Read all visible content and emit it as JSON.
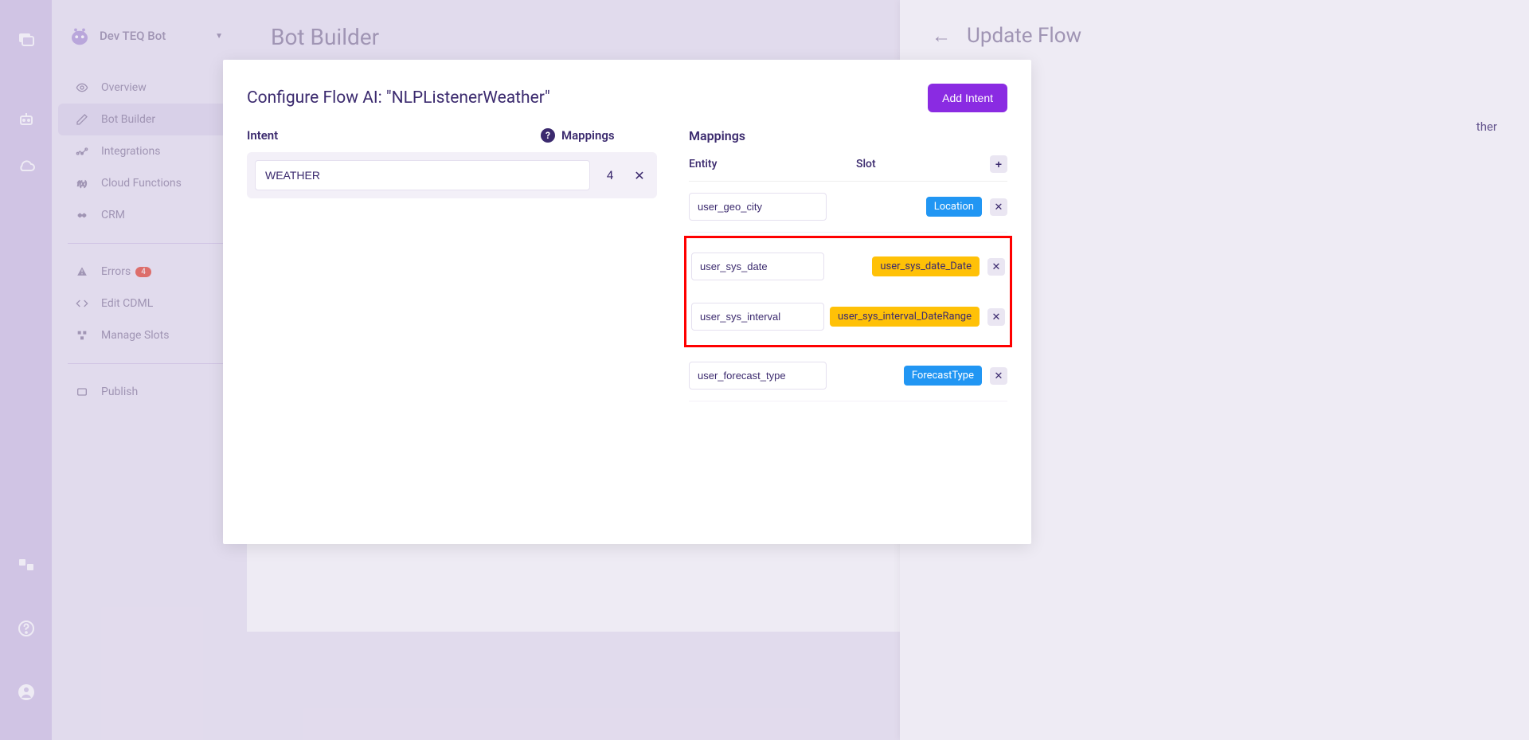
{
  "rail": {
    "icons": [
      "chat-icon",
      "bot-icon",
      "cloud-icon"
    ],
    "bottom_icons": [
      "translate-icon",
      "help-icon",
      "user-icon"
    ]
  },
  "sidebar": {
    "title": "Dev TEQ Bot",
    "items": [
      {
        "label": "Overview",
        "icon": "eye-icon"
      },
      {
        "label": "Bot Builder",
        "icon": "pencil-icon",
        "active": true
      },
      {
        "label": "Integrations",
        "icon": "share-icon"
      },
      {
        "label": "Cloud Functions",
        "icon": "function-icon"
      },
      {
        "label": "CRM",
        "icon": "handshake-icon"
      }
    ],
    "items2": [
      {
        "label": "Errors",
        "icon": "alert-icon",
        "badge": "4"
      },
      {
        "label": "Edit CDML",
        "icon": "code-icon"
      },
      {
        "label": "Manage Slots",
        "icon": "cubes-icon"
      }
    ],
    "items3": [
      {
        "label": "Publish",
        "icon": "publish-icon"
      }
    ]
  },
  "main": {
    "title": "Bot Builder"
  },
  "drawer": {
    "title": "Update Flow",
    "subpath_suffix": "ther"
  },
  "modal": {
    "title": "Configure Flow AI: \"NLPListenerWeather\"",
    "add_intent_label": "Add Intent",
    "columns": {
      "intent": "Intent",
      "mappings": "Mappings"
    },
    "intent_row": {
      "value": "WEATHER",
      "count": "4"
    },
    "mappings": {
      "title": "Mappings",
      "headers": {
        "entity": "Entity",
        "slot": "Slot"
      },
      "rows": [
        {
          "entity": "user_geo_city",
          "slot": "Location",
          "color": "blue",
          "highlight": false
        },
        {
          "entity": "user_sys_date",
          "slot": "user_sys_date_Date",
          "color": "yellow",
          "highlight": true
        },
        {
          "entity": "user_sys_interval",
          "slot": "user_sys_interval_DateRange",
          "color": "yellow",
          "highlight": true
        },
        {
          "entity": "user_forecast_type",
          "slot": "ForecastType",
          "color": "blue",
          "highlight": false
        }
      ]
    }
  }
}
